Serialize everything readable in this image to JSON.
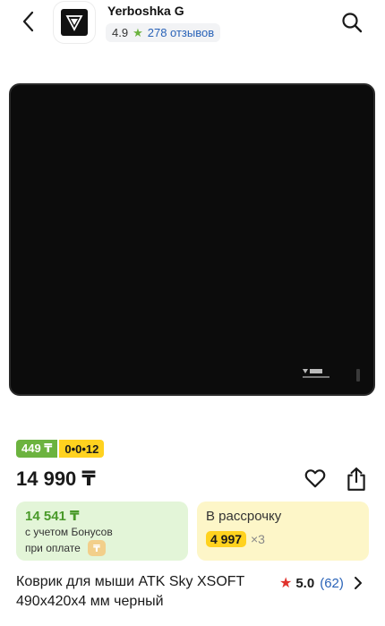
{
  "header": {
    "shop_name": "Yerboshka G",
    "rating": "4.9",
    "reviews": "278 отзывов"
  },
  "badges": {
    "price_short": "449 ₸",
    "installment": "0•0•12"
  },
  "price": "14 990 ₸",
  "bonus": {
    "amount": "14 541 ₸",
    "line1": "с учетом Бонусов",
    "line2": "при оплате"
  },
  "installment": {
    "title": "В рассрочку",
    "amount": "4 997",
    "times": "×3"
  },
  "product": {
    "title_line1": "Коврик для мыши ATK Sky XSOFT",
    "title_line2": "490x420x4 мм черный",
    "rating": "5.0",
    "reviews_count": "(62)"
  },
  "colors": {
    "green": "#6cb33f",
    "yellow": "#ffd21f",
    "link_blue": "#2a63b8",
    "star_red": "#e0322c"
  },
  "icons": [
    "back-arrow-icon",
    "search-icon",
    "star-icon",
    "heart-icon",
    "share-icon",
    "coin-icon",
    "chevron-right-icon"
  ]
}
